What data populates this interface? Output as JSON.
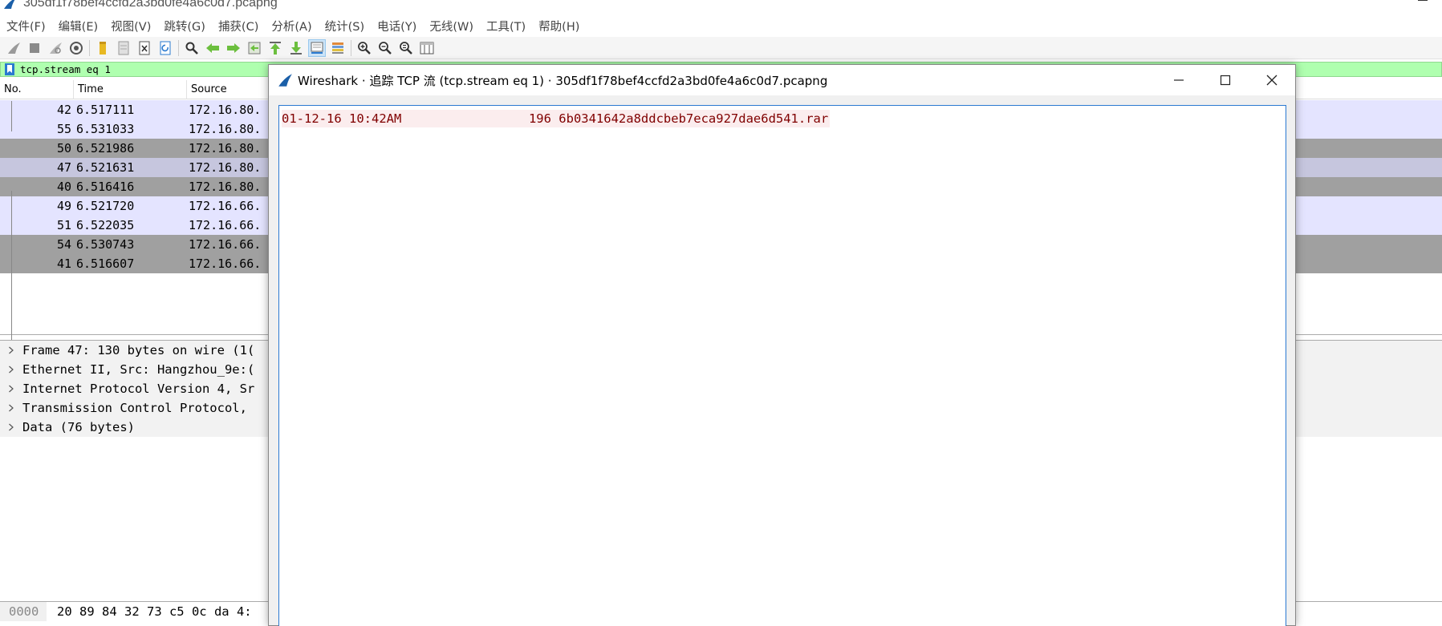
{
  "main_window": {
    "title": "305df1f78bef4ccfd2a3bd0fe4a6c0d7.pcapng"
  },
  "menu": [
    {
      "label": "文件(F)"
    },
    {
      "label": "编辑(E)"
    },
    {
      "label": "视图(V)"
    },
    {
      "label": "跳转(G)"
    },
    {
      "label": "捕获(C)"
    },
    {
      "label": "分析(A)"
    },
    {
      "label": "统计(S)"
    },
    {
      "label": "电话(Y)"
    },
    {
      "label": "无线(W)"
    },
    {
      "label": "工具(T)"
    },
    {
      "label": "帮助(H)"
    }
  ],
  "toolbar": {
    "icons": [
      "shark-fin-start-icon",
      "stop-capture-icon",
      "restart-capture-icon",
      "capture-options-icon",
      "open-file-icon",
      "save-file-icon",
      "close-file-icon",
      "reload-file-icon",
      "find-packet-icon",
      "go-back-icon",
      "go-forward-icon",
      "go-to-packet-icon",
      "go-first-icon",
      "go-last-icon",
      "autoscroll-icon",
      "colorize-icon",
      "zoom-in-icon",
      "zoom-out-icon",
      "zoom-normal-icon",
      "resize-columns-icon"
    ],
    "selected": "autoscroll-icon"
  },
  "filter": {
    "value": "tcp.stream eq 1"
  },
  "packet_list": {
    "columns": [
      "No.",
      "Time",
      "Source"
    ],
    "rows": [
      {
        "no": "42",
        "time": "6.517111",
        "source": "172.16.80.",
        "bg": "#e4e4ff"
      },
      {
        "no": "55",
        "time": "6.531033",
        "source": "172.16.80.",
        "bg": "#e4e4ff"
      },
      {
        "no": "50",
        "time": "6.521986",
        "source": "172.16.80.",
        "bg": "#a0a0a0"
      },
      {
        "no": "47",
        "time": "6.521631",
        "source": "172.16.80.",
        "bg": "#c6c6de"
      },
      {
        "no": "40",
        "time": "6.516416",
        "source": "172.16.80.",
        "bg": "#a0a0a0"
      },
      {
        "no": "49",
        "time": "6.521720",
        "source": "172.16.66.",
        "bg": "#e4e4ff"
      },
      {
        "no": "51",
        "time": "6.522035",
        "source": "172.16.66.",
        "bg": "#e4e4ff"
      },
      {
        "no": "54",
        "time": "6.530743",
        "source": "172.16.66.",
        "bg": "#a0a0a0"
      },
      {
        "no": "41",
        "time": "6.516607",
        "source": "172.16.66.",
        "bg": "#a0a0a0"
      }
    ]
  },
  "packet_details": [
    {
      "label": "Frame 47: 130 bytes on wire (1("
    },
    {
      "label": "Ethernet II, Src: Hangzhou_9e:("
    },
    {
      "label": "Internet Protocol Version 4, Sr"
    },
    {
      "label": "Transmission Control Protocol,"
    },
    {
      "label": "Data (76 bytes)"
    }
  ],
  "packet_bytes": {
    "offset": "0000",
    "hex": "20 89 84 32 73 c5 0c da  4:"
  },
  "dialog": {
    "title": "Wireshark · 追踪 TCP 流 (tcp.stream eq 1) · 305df1f78bef4ccfd2a3bd0fe4a6c0d7.pcapng",
    "stream_text": "01-12-16 10:42AM                 196 6b0341642a8ddcbeb7eca927dae6d541.rar"
  },
  "colors": {
    "filter_bg": "#afffaf",
    "stream_client_fg": "#800000",
    "stream_client_bg": "#fbedee",
    "dialog_border_accent": "#2b79d1"
  }
}
